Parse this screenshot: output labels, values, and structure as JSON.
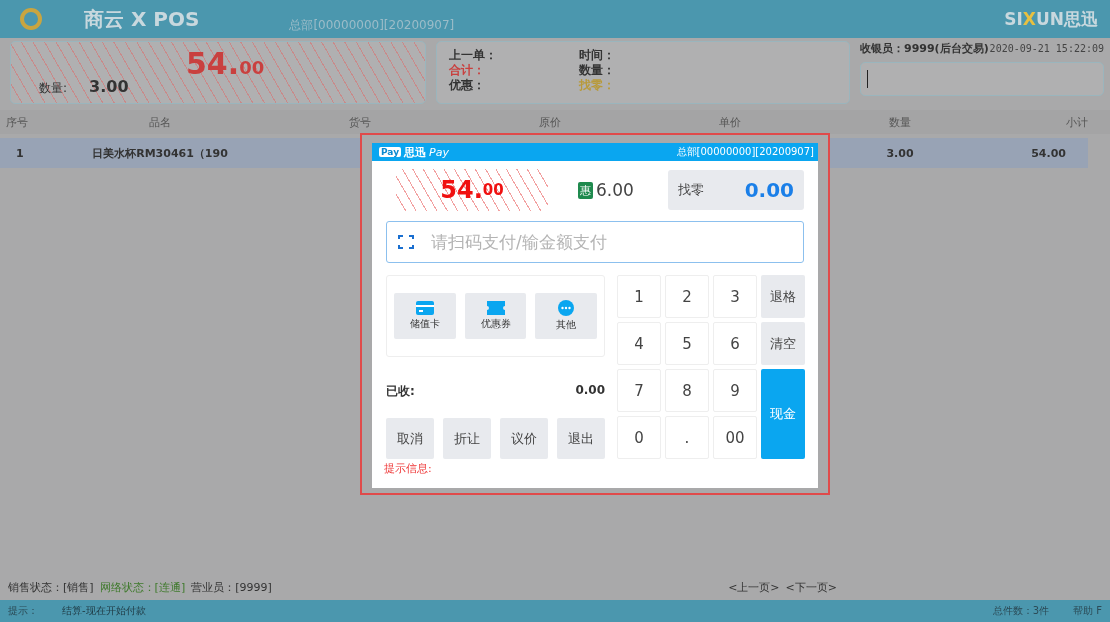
{
  "header": {
    "logo": "商云 X POS",
    "store": "总部[00000000][20200907]",
    "brand_a": "SI",
    "brand_x": "X",
    "brand_b": "UN思迅"
  },
  "summary": {
    "amount_main": "54.",
    "amount_cents": "00",
    "qty_label": "数量:",
    "qty": "3.00"
  },
  "info": [
    {
      "label": "上一单：",
      "color": "#333333"
    },
    {
      "label": "时间：",
      "color": "#333333"
    },
    {
      "label": "合计：",
      "color": "#c9403f"
    },
    {
      "label": "数量：",
      "color": "#333333"
    },
    {
      "label": "优惠：",
      "color": "#333333"
    },
    {
      "label": "找零：",
      "color": "#b89a3a"
    }
  ],
  "cashier": {
    "label": "收银员：9999(后台交易)",
    "datetime": "2020-09-21 15:22:09"
  },
  "table": {
    "columns": [
      "序号",
      "品名",
      "货号",
      "原价",
      "单价",
      "数量",
      "小计"
    ],
    "rows": [
      {
        "selected": true,
        "cells": [
          "1",
          "日美水杯RM30461（190",
          "",
          "",
          "",
          "3.00",
          "54.00"
        ]
      }
    ]
  },
  "status": [
    {
      "text": "销售状态：[销售]",
      "color": "#333333"
    },
    {
      "text": "网络状态：[连通]",
      "color": "#3f7a2c"
    },
    {
      "text": "营业员：[9999]",
      "color": "#333333"
    }
  ],
  "paging": [
    "<上一页>",
    "<下一页>"
  ],
  "footer": {
    "hint_label": "提示：",
    "hint": "结算-现在开始付款",
    "total": "总件数：3件",
    "help": "帮助 F"
  },
  "dialog": {
    "logo_badge": "Pay",
    "title_cn": "思迅",
    "title_pay": "Pay",
    "store": "总部[00000000][20200907]",
    "amount_main": "54.",
    "amount_cents": "00",
    "discount_badge": "惠",
    "discount": "6.00",
    "change_label": "找零",
    "change": "0.00",
    "placeholder": "请扫码支付/输金额支付",
    "methods": [
      {
        "label": "储值卡",
        "kind": "card"
      },
      {
        "label": "优惠券",
        "kind": "coupon"
      },
      {
        "label": "其他",
        "kind": "more"
      }
    ],
    "received_label": "已收:",
    "received": "0.00",
    "actions": [
      "取消",
      "折让",
      "议价",
      "退出"
    ],
    "keys": [
      {
        "label": "1",
        "kind": "digit"
      },
      {
        "label": "2",
        "kind": "digit"
      },
      {
        "label": "3",
        "kind": "digit"
      },
      {
        "label": "退格",
        "kind": "function"
      },
      {
        "label": "4",
        "kind": "digit"
      },
      {
        "label": "5",
        "kind": "digit"
      },
      {
        "label": "6",
        "kind": "digit"
      },
      {
        "label": "清空",
        "kind": "function"
      },
      {
        "label": "7",
        "kind": "digit"
      },
      {
        "label": "8",
        "kind": "digit"
      },
      {
        "label": "9",
        "kind": "digit"
      },
      {
        "label": "现金",
        "kind": "primary"
      },
      {
        "label": "0",
        "kind": "digit"
      },
      {
        "label": ".",
        "kind": "digit"
      },
      {
        "label": "00",
        "kind": "digit"
      }
    ],
    "hint": "提示信息:"
  }
}
